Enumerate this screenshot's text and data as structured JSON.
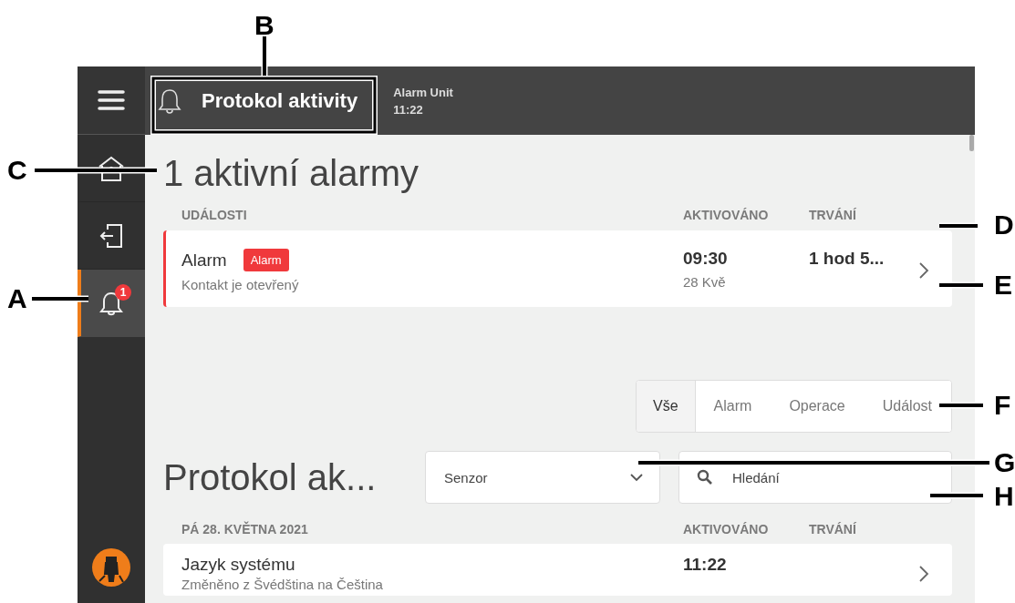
{
  "header": {
    "title": "Protokol aktivity",
    "unit": "Alarm Unit",
    "time": "11:22"
  },
  "sidebar": {
    "items": [
      {
        "kind": "home",
        "selected": false
      },
      {
        "kind": "logout",
        "selected": false
      },
      {
        "kind": "alarms",
        "selected": true,
        "badge": "1"
      }
    ]
  },
  "active_alarms": {
    "title": "1 aktivní alarmy",
    "columns": [
      "UDÁLOSTI",
      "AKTIVOVÁNO",
      "TRVÁNÍ"
    ],
    "rows": [
      {
        "name": "Alarm",
        "tag": "Alarm",
        "detail": "Kontakt je otevřený",
        "time": "09:30",
        "date": "28 Kvě",
        "duration": "1 hod 5...",
        "color": "#f0393c"
      }
    ]
  },
  "filters": [
    {
      "label": "Vše",
      "selected": true
    },
    {
      "label": "Alarm",
      "selected": false
    },
    {
      "label": "Operace",
      "selected": false
    },
    {
      "label": "Událost",
      "selected": false
    }
  ],
  "log": {
    "title": "Protokol ak...",
    "sensor_select": {
      "value": "Senzor"
    },
    "search": {
      "placeholder": "Hledání"
    },
    "columns": [
      "PÁ 28. KVĚTNA 2021",
      "AKTIVOVÁNO",
      "TRVÁNÍ"
    ],
    "rows": [
      {
        "name": "Jazyk systému",
        "detail": "Změněno z Švédština na Čeština",
        "time": "11:22"
      }
    ]
  },
  "callouts": [
    "A",
    "B",
    "C",
    "D",
    "E",
    "F",
    "G",
    "H"
  ]
}
